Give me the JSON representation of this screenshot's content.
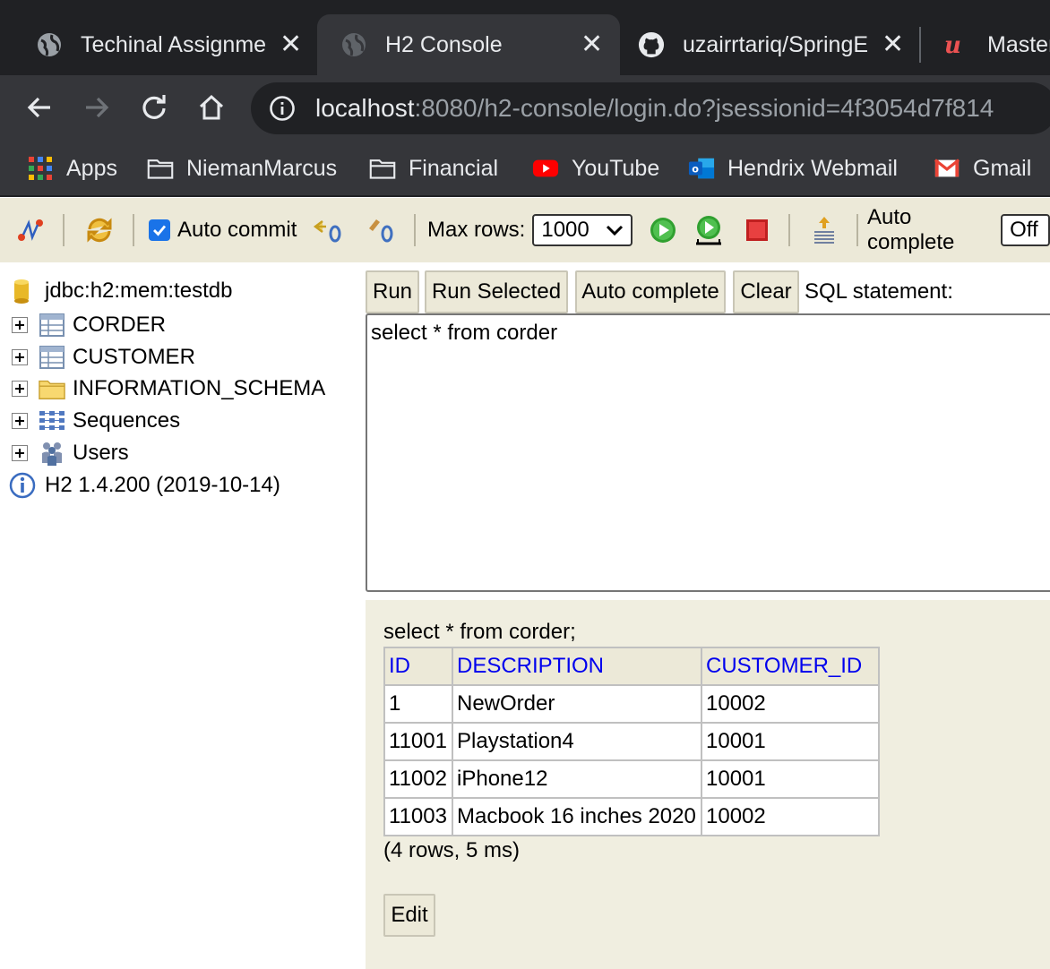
{
  "browser": {
    "tabs": [
      {
        "title": "Techinal Assignme",
        "active": false,
        "favicon": "globe-icon"
      },
      {
        "title": "H2 Console",
        "active": true,
        "favicon": "globe-icon"
      },
      {
        "title": "uzairrtariq/SpringE",
        "active": false,
        "favicon": "github-icon"
      },
      {
        "title": "Master",
        "active": false,
        "favicon": "udemy-icon"
      }
    ],
    "url_host": "localhost",
    "url_rest": ":8080/h2-console/login.do?jsessionid=4f3054d7f814",
    "bookmarks": [
      {
        "label": "Apps",
        "icon": "apps-grid-icon"
      },
      {
        "label": "NiemanMarcus",
        "icon": "folder-icon"
      },
      {
        "label": "Financial",
        "icon": "folder-icon"
      },
      {
        "label": "YouTube",
        "icon": "youtube-icon"
      },
      {
        "label": "Hendrix Webmail",
        "icon": "outlook-icon"
      },
      {
        "label": "Gmail",
        "icon": "gmail-icon"
      }
    ]
  },
  "toolbar": {
    "auto_commit_label": "Auto commit",
    "auto_commit_checked": true,
    "max_rows_label": "Max rows:",
    "max_rows_value": "1000",
    "auto_complete_label": "Auto complete",
    "auto_complete_value": "Off"
  },
  "tree": {
    "connection": "jdbc:h2:mem:testdb",
    "items": [
      {
        "label": "CORDER",
        "icon": "table-icon"
      },
      {
        "label": "CUSTOMER",
        "icon": "table-icon"
      },
      {
        "label": "INFORMATION_SCHEMA",
        "icon": "folder-icon"
      },
      {
        "label": "Sequences",
        "icon": "sequences-icon"
      },
      {
        "label": "Users",
        "icon": "users-icon"
      }
    ],
    "version": "H2 1.4.200 (2019-10-14)"
  },
  "query": {
    "buttons": {
      "run": "Run",
      "run_selected": "Run Selected",
      "auto_complete": "Auto complete",
      "clear": "Clear"
    },
    "sql_label": "SQL statement:",
    "sql_text": "select * from corder"
  },
  "result": {
    "statement": "select * from corder;",
    "columns": [
      "ID",
      "DESCRIPTION",
      "CUSTOMER_ID"
    ],
    "rows": [
      [
        "1",
        "NewOrder",
        "10002"
      ],
      [
        "11001",
        "Playstation4",
        "10001"
      ],
      [
        "11002",
        "iPhone12",
        "10001"
      ],
      [
        "11003",
        "Macbook 16 inches 2020",
        "10002"
      ]
    ],
    "summary": "(4 rows, 5 ms)",
    "edit_label": "Edit"
  },
  "colors": {
    "tab_bg": "#202124",
    "toolbar_bg": "#35363a",
    "h2_toolbar_bg": "#ece9d8",
    "result_bg": "#f0eee0",
    "header_link": "#0000ee"
  }
}
